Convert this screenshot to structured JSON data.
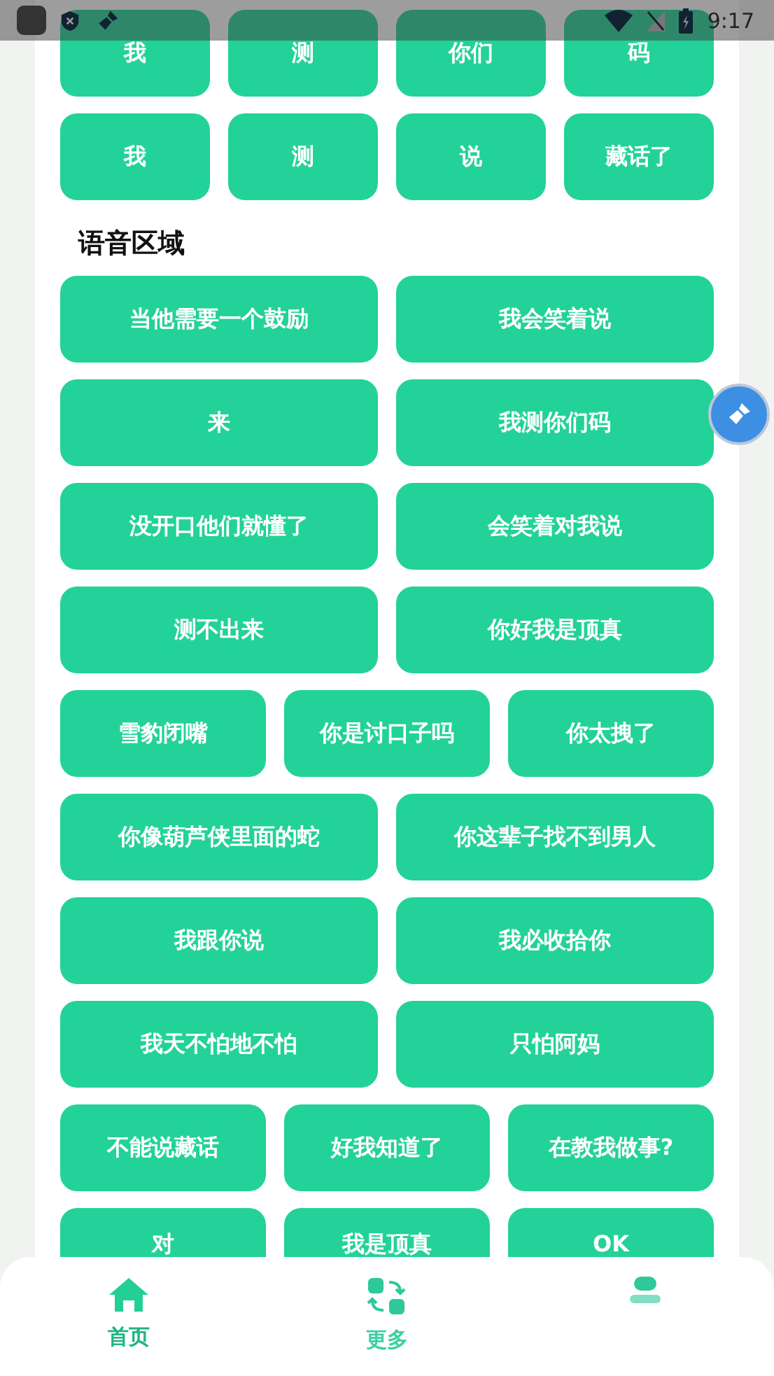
{
  "status_bar": {
    "time": "9:17"
  },
  "top_rows": [
    [
      "我",
      "测",
      "你们",
      "码"
    ],
    [
      "我",
      "测",
      "说",
      "藏话了"
    ]
  ],
  "section": {
    "title": "语音区域",
    "rows": [
      [
        "当他需要一个鼓励",
        "我会笑着说"
      ],
      [
        "来",
        "我测你们码"
      ],
      [
        "没开口他们就懂了",
        "会笑着对我说"
      ],
      [
        "测不出来",
        "你好我是顶真"
      ],
      [
        "雪豹闭嘴",
        "你是讨口子吗",
        "你太拽了"
      ],
      [
        "你像葫芦侠里面的蛇",
        "你这辈子找不到男人"
      ],
      [
        "我跟你说",
        "我必收拾你"
      ],
      [
        "我天不怕地不怕",
        "只怕阿妈"
      ],
      [
        "不能说藏话",
        "好我知道了",
        "在教我做事?"
      ],
      [
        "对",
        "我是顶真",
        "OK"
      ]
    ]
  },
  "nav": [
    {
      "kind": "home",
      "label": "首页",
      "selected": true
    },
    {
      "kind": "more",
      "label": "更多",
      "selected": false
    },
    {
      "kind": "user",
      "selected": false
    }
  ]
}
